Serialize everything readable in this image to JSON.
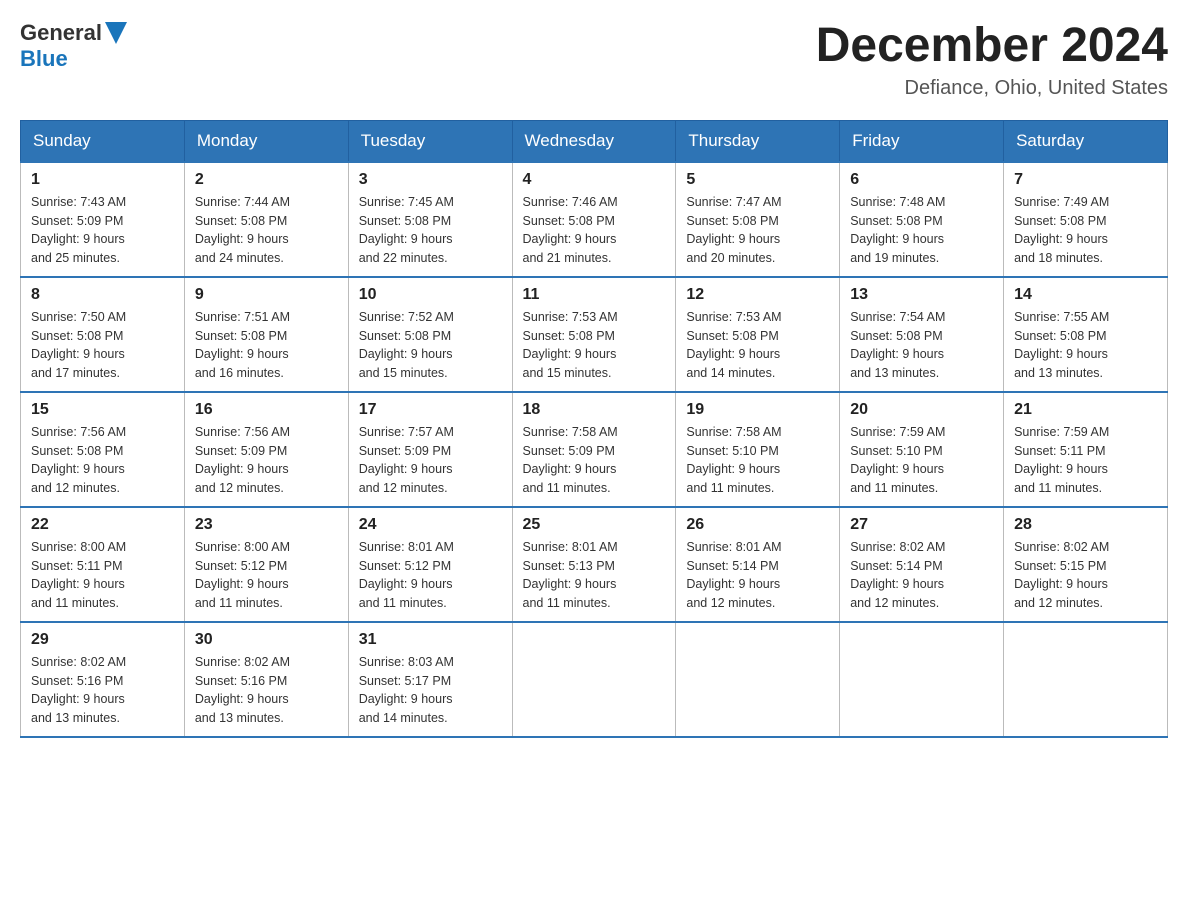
{
  "logo": {
    "line1": "General",
    "line2": "Blue",
    "icon": "▶"
  },
  "title": "December 2024",
  "location": "Defiance, Ohio, United States",
  "days_of_week": [
    "Sunday",
    "Monday",
    "Tuesday",
    "Wednesday",
    "Thursday",
    "Friday",
    "Saturday"
  ],
  "weeks": [
    [
      {
        "num": "1",
        "sunrise": "7:43 AM",
        "sunset": "5:09 PM",
        "daylight": "9 hours and 25 minutes."
      },
      {
        "num": "2",
        "sunrise": "7:44 AM",
        "sunset": "5:08 PM",
        "daylight": "9 hours and 24 minutes."
      },
      {
        "num": "3",
        "sunrise": "7:45 AM",
        "sunset": "5:08 PM",
        "daylight": "9 hours and 22 minutes."
      },
      {
        "num": "4",
        "sunrise": "7:46 AM",
        "sunset": "5:08 PM",
        "daylight": "9 hours and 21 minutes."
      },
      {
        "num": "5",
        "sunrise": "7:47 AM",
        "sunset": "5:08 PM",
        "daylight": "9 hours and 20 minutes."
      },
      {
        "num": "6",
        "sunrise": "7:48 AM",
        "sunset": "5:08 PM",
        "daylight": "9 hours and 19 minutes."
      },
      {
        "num": "7",
        "sunrise": "7:49 AM",
        "sunset": "5:08 PM",
        "daylight": "9 hours and 18 minutes."
      }
    ],
    [
      {
        "num": "8",
        "sunrise": "7:50 AM",
        "sunset": "5:08 PM",
        "daylight": "9 hours and 17 minutes."
      },
      {
        "num": "9",
        "sunrise": "7:51 AM",
        "sunset": "5:08 PM",
        "daylight": "9 hours and 16 minutes."
      },
      {
        "num": "10",
        "sunrise": "7:52 AM",
        "sunset": "5:08 PM",
        "daylight": "9 hours and 15 minutes."
      },
      {
        "num": "11",
        "sunrise": "7:53 AM",
        "sunset": "5:08 PM",
        "daylight": "9 hours and 15 minutes."
      },
      {
        "num": "12",
        "sunrise": "7:53 AM",
        "sunset": "5:08 PM",
        "daylight": "9 hours and 14 minutes."
      },
      {
        "num": "13",
        "sunrise": "7:54 AM",
        "sunset": "5:08 PM",
        "daylight": "9 hours and 13 minutes."
      },
      {
        "num": "14",
        "sunrise": "7:55 AM",
        "sunset": "5:08 PM",
        "daylight": "9 hours and 13 minutes."
      }
    ],
    [
      {
        "num": "15",
        "sunrise": "7:56 AM",
        "sunset": "5:08 PM",
        "daylight": "9 hours and 12 minutes."
      },
      {
        "num": "16",
        "sunrise": "7:56 AM",
        "sunset": "5:09 PM",
        "daylight": "9 hours and 12 minutes."
      },
      {
        "num": "17",
        "sunrise": "7:57 AM",
        "sunset": "5:09 PM",
        "daylight": "9 hours and 12 minutes."
      },
      {
        "num": "18",
        "sunrise": "7:58 AM",
        "sunset": "5:09 PM",
        "daylight": "9 hours and 11 minutes."
      },
      {
        "num": "19",
        "sunrise": "7:58 AM",
        "sunset": "5:10 PM",
        "daylight": "9 hours and 11 minutes."
      },
      {
        "num": "20",
        "sunrise": "7:59 AM",
        "sunset": "5:10 PM",
        "daylight": "9 hours and 11 minutes."
      },
      {
        "num": "21",
        "sunrise": "7:59 AM",
        "sunset": "5:11 PM",
        "daylight": "9 hours and 11 minutes."
      }
    ],
    [
      {
        "num": "22",
        "sunrise": "8:00 AM",
        "sunset": "5:11 PM",
        "daylight": "9 hours and 11 minutes."
      },
      {
        "num": "23",
        "sunrise": "8:00 AM",
        "sunset": "5:12 PM",
        "daylight": "9 hours and 11 minutes."
      },
      {
        "num": "24",
        "sunrise": "8:01 AM",
        "sunset": "5:12 PM",
        "daylight": "9 hours and 11 minutes."
      },
      {
        "num": "25",
        "sunrise": "8:01 AM",
        "sunset": "5:13 PM",
        "daylight": "9 hours and 11 minutes."
      },
      {
        "num": "26",
        "sunrise": "8:01 AM",
        "sunset": "5:14 PM",
        "daylight": "9 hours and 12 minutes."
      },
      {
        "num": "27",
        "sunrise": "8:02 AM",
        "sunset": "5:14 PM",
        "daylight": "9 hours and 12 minutes."
      },
      {
        "num": "28",
        "sunrise": "8:02 AM",
        "sunset": "5:15 PM",
        "daylight": "9 hours and 12 minutes."
      }
    ],
    [
      {
        "num": "29",
        "sunrise": "8:02 AM",
        "sunset": "5:16 PM",
        "daylight": "9 hours and 13 minutes."
      },
      {
        "num": "30",
        "sunrise": "8:02 AM",
        "sunset": "5:16 PM",
        "daylight": "9 hours and 13 minutes."
      },
      {
        "num": "31",
        "sunrise": "8:03 AM",
        "sunset": "5:17 PM",
        "daylight": "9 hours and 14 minutes."
      },
      null,
      null,
      null,
      null
    ]
  ],
  "labels": {
    "sunrise": "Sunrise:",
    "sunset": "Sunset:",
    "daylight": "Daylight:"
  }
}
